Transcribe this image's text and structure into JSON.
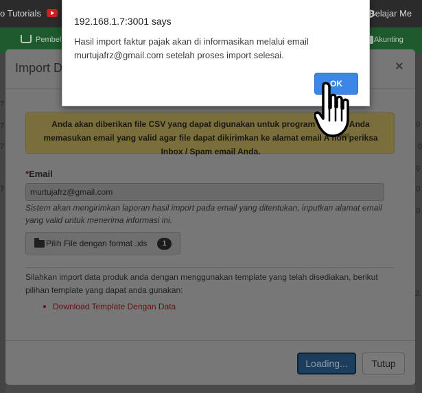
{
  "bookmarks": {
    "left_label": "o Tutorials",
    "right_label": "Belajar Me"
  },
  "app_nav": {
    "pembelian_label": "Pembel",
    "akunting_label": "Akunting"
  },
  "background_edge": {
    "right_numbers": [
      "0",
      "0",
      "0",
      "0",
      "0",
      "2,"
    ],
    "left_numbers": [
      "7",
      "7",
      "7",
      "7"
    ]
  },
  "modal": {
    "title": "Import D",
    "close_glyph": "×",
    "alert_text": "Anda akan diberikan file CSV yang dapat digunakan untuk program E-Fak     n Anda memasukan email yang valid agar file dapat dikirimkan ke alamat email A     hon periksa Inbox / Spam email Anda.",
    "email_label": "Email",
    "email_required_mark": "*",
    "email_value": "murtujafrz@gmail.com",
    "help_text": "Sistem akan mengirimkan laporan hasil import pada email yang ditentukan, inputkan alamat email yang valid untuk menerima informasi ini.",
    "file_button_label": "Pilih File dengan format .xls",
    "file_badge": "1",
    "template_text": "Silahkan import data produk anda dengan menggunakan template yang telah disediakan, berikut pilihan template yang dapat anda gunakan:",
    "template_link": "Download Template Dengan Data",
    "loading_button": "Loading...",
    "close_button": "Tutup"
  },
  "dialog": {
    "title": "192.168.1.7:3001 says",
    "message": "Hasil import faktur pajak akan di informasikan melalui email murtujafrz@gmail.com setelah proses import selesai.",
    "ok_label": "OK",
    "ok_color": "#3b86e6"
  },
  "cursor": {
    "icon": "hand-pointer-icon"
  }
}
